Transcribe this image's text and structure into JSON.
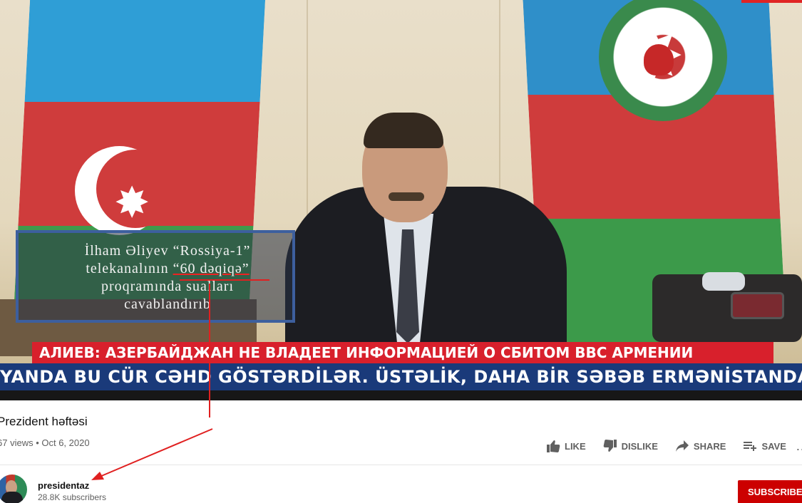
{
  "video": {
    "caption_lines": [
      "İlham Əliyev “Rossiya-1”",
      "telekanalının ",
      "“60 dəqiqə”",
      "proqramında sualları",
      "cavablandırıb"
    ],
    "ticker_top": "АЛИЕВ: АЗЕРБАЙДЖАН НЕ ВЛАДЕЕТ ИНФОРМАЦИЕЙ О СБИТОМ BBC АРМЕНИИ",
    "ticker_bottom": "YANDA BU CÜR CƏHD GÖSTƏRDİLƏR. ÜSTƏLİK, DAHA BİR SƏBƏB ERMƏNİSTANDA MÖ"
  },
  "meta": {
    "title": "Prezident həftəsi",
    "views_date": "67 views • Oct 6, 2020"
  },
  "actions": {
    "like": "LIKE",
    "dislike": "DISLIKE",
    "share": "SHARE",
    "save": "SAVE",
    "more": "..."
  },
  "channel": {
    "name": "presidentaz",
    "subscribers": "28.8K subscribers",
    "subscribe_label": "SUBSCRIBE"
  },
  "colors": {
    "subscribe_bg": "#cc0000",
    "ticker_red": "#d8202c",
    "ticker_blue": "#1a3a7a",
    "annotation": "#e02020"
  }
}
